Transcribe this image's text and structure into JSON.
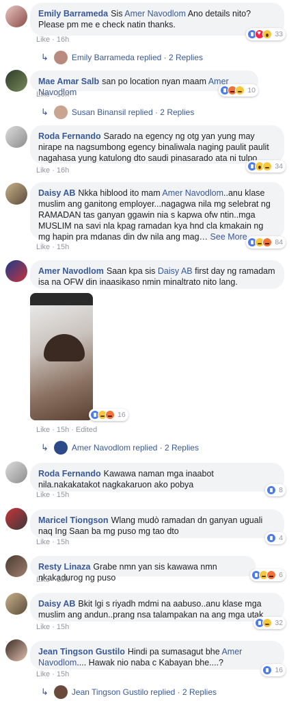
{
  "labels": {
    "like": "Like",
    "more": "See More",
    "edited": "Edited"
  },
  "comments": [
    {
      "name": "Emily Barrameda",
      "pre": "Sis ",
      "tag": "Amer Navodlom",
      "post": " Ano details nito? Please pm me e check natin thanks.",
      "time": "16h",
      "count": "33",
      "reply": {
        "text": "Emily Barrameda replied · 2 Replies"
      }
    },
    {
      "name": "Mae Amar Salb",
      "pre": "san po location nyan maam ",
      "tag": "Amer Navodlom",
      "post": "",
      "time": "16h",
      "count": "10",
      "reply": {
        "text": "Susan Binansil replied · 2 Replies"
      }
    },
    {
      "name": "Roda Fernando",
      "pre": "Sarado na egency ng otg yan yung may nirape na nagsumbong egency binaliwala naging paulit paulit nagahasa yung katulong dto saudi pinasarado ata ni tulpo",
      "tag": "",
      "post": "",
      "time": "16h",
      "count": "34"
    },
    {
      "name": "Daisy AB",
      "pre": "Nkka hiblood ito mam ",
      "tag": "Amer Navodlom",
      "post": "..anu klase muslim ang ganitong employer...nagagwa nila mg selebrat ng RAMADAN tas ganyan ggawin nia s kapwa ofw ntin..mga MUSLIM na savi nla kpag ramadan kya hnd cla kmakain ng mg hapin pra mdanas din dw nila ang mag… ",
      "time": "15h",
      "count": "84"
    },
    {
      "name": "Amer Navodlom",
      "pre": "Saan kpa sis ",
      "tag": "Daisy AB",
      "post": " first day ng ramadam isa na OFW din inaasikaso nmin minaltrato nito lang.",
      "time": "15h",
      "count": "16",
      "reply": {
        "text": "Amer Navodlom replied · 2 Replies"
      }
    },
    {
      "name": "Roda Fernando",
      "pre": "Kawawa naman mga inaabot nila.nakakatakot nagkakaruon ako pobya",
      "tag": "",
      "post": "",
      "time": "15h",
      "count": "8"
    },
    {
      "name": "Maricel Tiongson",
      "pre": "Wlang mudò ramadan dn ganyan uguali naq Ing Saan ba mg puso mg tao dto",
      "tag": "",
      "post": "",
      "time": "15h",
      "count": "4"
    },
    {
      "name": "Resty Linaza",
      "pre": "Grabe nmn yan sis kawawa nmn nkakadurog ng puso",
      "tag": "",
      "post": "",
      "time": "15h",
      "count": "6"
    },
    {
      "name": "Daisy AB",
      "pre": "Bkit lgi s riyadh mdmi na aabuso..anu klase mga muslim ang andun..prang nsa talampakan na ang mga utak",
      "tag": "",
      "post": "",
      "time": "15h",
      "count": "32"
    },
    {
      "name": "Jean Tingson Gustilo",
      "pre": "Hindi pa sumasagut bhe ",
      "tag": "Amer Navodlom",
      "post": ".... Hawak nio naba c Kabayan bhe....?",
      "time": "15h",
      "count": "16",
      "reply": {
        "text": "Jean Tingson Gustilo replied · 2 Replies"
      }
    }
  ],
  "reactions": [
    [
      "like",
      "love",
      "wow"
    ],
    [
      "like",
      "angry",
      "sad"
    ],
    [
      "like",
      "wow",
      "sad"
    ],
    [
      "like",
      "sad",
      "angry"
    ],
    [
      "like",
      "sad",
      "angry"
    ],
    [
      "like"
    ],
    [
      "like"
    ],
    [
      "like",
      "sad",
      "angry"
    ],
    [
      "like",
      "sad"
    ],
    [
      "like"
    ]
  ],
  "colors": {
    "link": "#385898",
    "bubble": "#f2f3f5",
    "meta": "#90949c"
  }
}
